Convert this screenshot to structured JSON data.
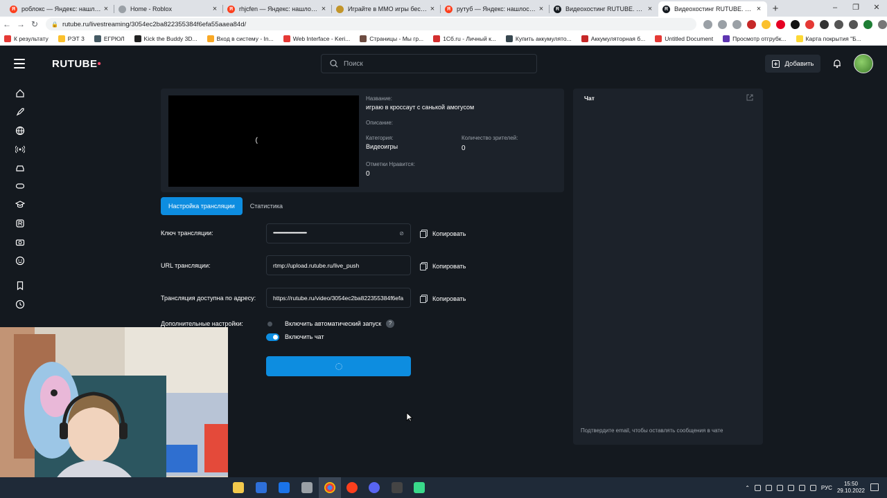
{
  "browser": {
    "tabs": [
      {
        "title": "роблокс — Яндекс: нашлось 7",
        "fav_color": "#fc3f1d",
        "fav_text": "Я"
      },
      {
        "title": "Home - Roblox",
        "fav_color": "#9aa0a6",
        "fav_text": ""
      },
      {
        "title": "rhjcfen — Яндекс: нашлось 3 т",
        "fav_color": "#fc3f1d",
        "fav_text": "Я"
      },
      {
        "title": "Играйте в ММО игры бесплат",
        "fav_color": "#c2952a",
        "fav_text": ""
      },
      {
        "title": "рутуб — Яндекс: нашлось 4 м",
        "fav_color": "#fc3f1d",
        "fav_text": "Я"
      },
      {
        "title": "Видеохостинг RUTUBE. Смотр",
        "fav_color": "#14191f",
        "fav_text": "R"
      },
      {
        "title": "Видеохостинг RUTUBE. Смотр",
        "fav_color": "#14191f",
        "fav_text": "R"
      }
    ],
    "new_tab": "+",
    "url": "rutube.ru/livestreaming/3054ec2ba822355384f6efa55aaea84d/",
    "bookmarks": [
      {
        "label": "К результату",
        "color": "#e53935"
      },
      {
        "label": "РЭТ 3",
        "color": "#fbc02d"
      },
      {
        "label": "ЕГРЮЛ",
        "color": "#455a64"
      },
      {
        "label": "Kick the Buddy 3D...",
        "color": "#212121"
      },
      {
        "label": "Вход в систему - In...",
        "color": "#f9a825"
      },
      {
        "label": "Web Interface - Keri...",
        "color": "#e53935"
      },
      {
        "label": "Страницы - Мы гр...",
        "color": "#6d4c41"
      },
      {
        "label": "1Сб.ru - Личный к...",
        "color": "#d32f2f"
      },
      {
        "label": "Купить аккумулято...",
        "color": "#37474f"
      },
      {
        "label": "Аккумуляторная б...",
        "color": "#c62828"
      },
      {
        "label": "Untitled Document",
        "color": "#e53935"
      },
      {
        "label": "Просмотр отгрубк...",
        "color": "#5e35b1"
      },
      {
        "label": "Карта покрытия \"Б...",
        "color": "#fdd835"
      }
    ]
  },
  "header": {
    "logo": "RUTUBE",
    "search_placeholder": "Поиск",
    "add_label": "Добавить"
  },
  "stream": {
    "name_label": "Название:",
    "name_value": "играю в кроссаут с санькой амогусом",
    "desc_label": "Описание:",
    "category_label": "Категория:",
    "category_value": "Видеоигры",
    "viewers_label": "Количество зрителей:",
    "viewers_value": "0",
    "likes_label": "Отметки Нравится:",
    "likes_value": "0"
  },
  "tabs": [
    {
      "label": "Настройка трансляции"
    },
    {
      "label": "Статистика"
    }
  ],
  "settings": {
    "key_label": "Ключ трансляции:",
    "key_value": "••••••••••••••••••••••••••••••••••••••••••••••••••",
    "url_label": "URL трансляции:",
    "url_value": "rtmp://upload.rutube.ru/live_push",
    "address_label": "Трансляция доступна по адресу:",
    "address_value": "https://rutube.ru/video/3054ec2ba822355384f6efa",
    "copy_label": "Копировать",
    "extra_label": "Дополнительные настройки:",
    "autostart_label": "Включить автоматический запуск",
    "autostart_on": false,
    "chat_label": "Включить чат",
    "chat_on": true,
    "help": "?"
  },
  "chat": {
    "title": "Чат",
    "footer": "Подтвердите email, чтобы оставлять сообщения в чате"
  },
  "taskbar": {
    "lang": "РУС",
    "time": "15:50",
    "date": "29.10.2022"
  },
  "colors": {
    "accent": "#0d8de0",
    "background": "#14191f",
    "panel": "#1c222a"
  }
}
